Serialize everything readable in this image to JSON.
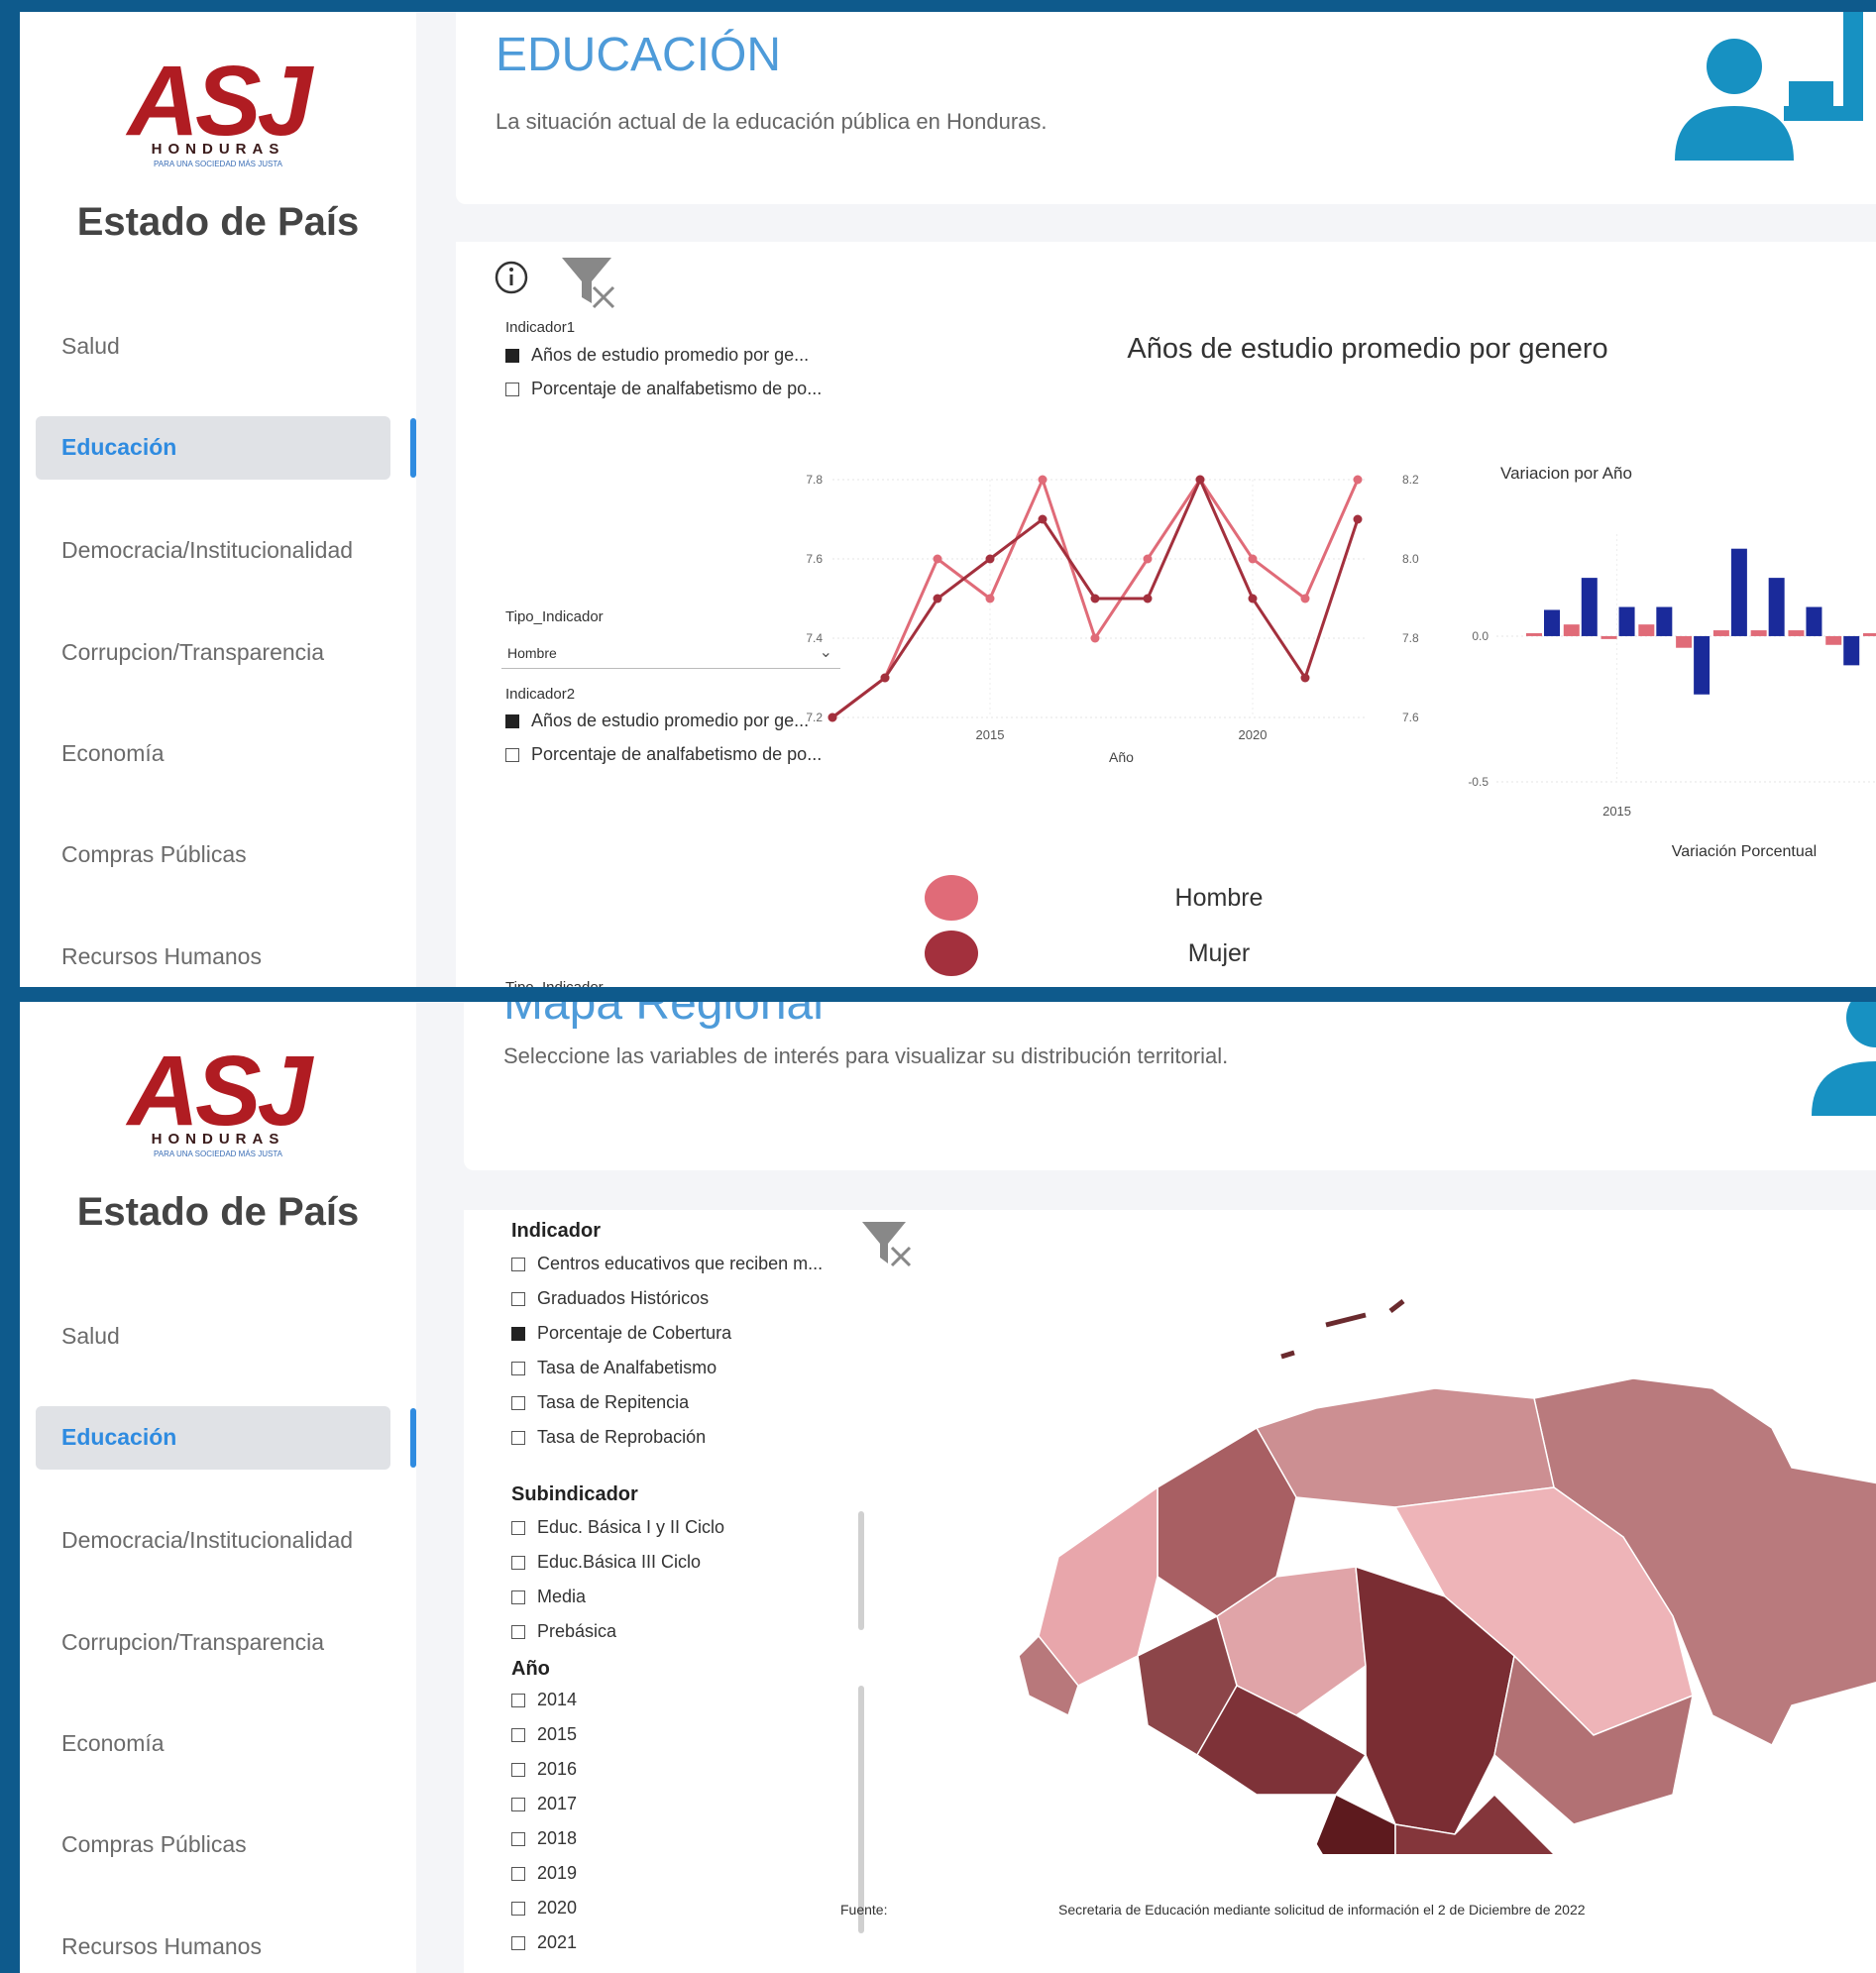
{
  "sidebar": {
    "logo_text": "ASJ",
    "logo_country": "HONDURAS",
    "logo_tagline": "PARA UNA SOCIEDAD MÁS JUSTA",
    "title": "Estado de País",
    "items": [
      "Salud",
      "Educación",
      "Democracia/Institucionalidad",
      "Corrupcion/Transparencia",
      "Economía",
      "Compras Públicas",
      "Recursos Humanos"
    ],
    "active": "Educación"
  },
  "page1": {
    "title": "EDUCACIÓN",
    "subtitle": "La situación actual de la educación pública en Honduras.",
    "filters": {
      "indicador1_label": "Indicador1",
      "indicador1_options": [
        {
          "label": "Años de estudio promedio por ge...",
          "checked": true
        },
        {
          "label": "Porcentaje de analfabetismo de po...",
          "checked": false
        }
      ],
      "tipo_label": "Tipo_Indicador",
      "tipo_value": "Hombre",
      "indicador2_label": "Indicador2",
      "indicador2_options": [
        {
          "label": "Años de estudio promedio por ge...",
          "checked": true
        },
        {
          "label": "Porcentaje de analfabetismo de po...",
          "checked": false
        }
      ],
      "tipo2_label": "Tipo_Indicador"
    },
    "chart_title": "Años de estudio promedio por genero",
    "legend": [
      {
        "name": "Hombre",
        "color": "#e06b78"
      },
      {
        "name": "Mujer",
        "color": "#a3303d"
      }
    ]
  },
  "page2": {
    "title": "Mapa Regional",
    "subtitle": "Seleccione las variables de interés para visualizar su distribución territorial.",
    "indicador_label": "Indicador",
    "indicador_options": [
      {
        "label": "Centros educativos que reciben m...",
        "checked": false
      },
      {
        "label": "Graduados Históricos",
        "checked": false
      },
      {
        "label": "Porcentaje de Cobertura",
        "checked": true
      },
      {
        "label": "Tasa de Analfabetismo",
        "checked": false
      },
      {
        "label": "Tasa de Repitencia",
        "checked": false
      },
      {
        "label": "Tasa de Reprobación",
        "checked": false
      }
    ],
    "subindicador_label": "Subindicador",
    "subindicador_options": [
      {
        "label": "Educ. Básica I y II Ciclo",
        "checked": false
      },
      {
        "label": "Educ.Básica III Ciclo",
        "checked": false
      },
      {
        "label": "Media",
        "checked": false
      },
      {
        "label": "Prebásica",
        "checked": false
      }
    ],
    "anio_label": "Año",
    "anio_options": [
      {
        "label": "2014",
        "checked": false
      },
      {
        "label": "2015",
        "checked": false
      },
      {
        "label": "2016",
        "checked": false
      },
      {
        "label": "2017",
        "checked": false
      },
      {
        "label": "2018",
        "checked": false
      },
      {
        "label": "2019",
        "checked": false
      },
      {
        "label": "2020",
        "checked": false
      },
      {
        "label": "2021",
        "checked": false
      }
    ],
    "source_label": "Fuente:",
    "source_text": "Secretaria de Educación mediante solicitud de información el 2 de Diciembre de 2022"
  },
  "chart_data": [
    {
      "type": "line",
      "title": "Años de estudio promedio por genero",
      "xlabel": "Año",
      "x": [
        2012,
        2013,
        2014,
        2015,
        2016,
        2017,
        2018,
        2019,
        2020,
        2021,
        2022
      ],
      "x_ticks": [
        "2015",
        "2020"
      ],
      "series": [
        {
          "name": "Hombre",
          "axis": "left",
          "values": [
            7.2,
            7.3,
            7.6,
            7.5,
            7.8,
            7.4,
            7.6,
            7.8,
            7.6,
            7.5,
            7.8
          ]
        },
        {
          "name": "Mujer",
          "axis": "right",
          "values": [
            7.6,
            7.7,
            7.9,
            8.0,
            8.1,
            7.9,
            7.9,
            8.2,
            7.9,
            7.7,
            8.1
          ]
        }
      ],
      "ylim_left": [
        7.2,
        7.8
      ],
      "yticks_left": [
        "7.2",
        "7.4",
        "7.6",
        "7.8"
      ],
      "ylim_right": [
        7.6,
        8.2
      ],
      "yticks_right": [
        "7.6",
        "7.8",
        "8.0",
        "8.2"
      ]
    },
    {
      "type": "bar",
      "title": "Variacion por Año",
      "xlabel": "Variación Porcentual",
      "x": [
        2013,
        2014,
        2015,
        2016,
        2017,
        2018,
        2019,
        2020,
        2021,
        2022
      ],
      "x_ticks": [
        "2015"
      ],
      "series": [
        {
          "name": "Hombre",
          "values": [
            0.01,
            0.04,
            -0.01,
            0.04,
            -0.04,
            0.02,
            0.02,
            0.02,
            -0.03,
            0.01
          ]
        },
        {
          "name": "Mujer",
          "values": [
            0.09,
            0.2,
            0.1,
            0.1,
            -0.2,
            0.3,
            0.2,
            0.1,
            -0.1,
            0.3
          ]
        }
      ],
      "ylim": [
        -0.5,
        0.0
      ],
      "yticks": [
        "-0.5",
        "0.0"
      ]
    }
  ]
}
